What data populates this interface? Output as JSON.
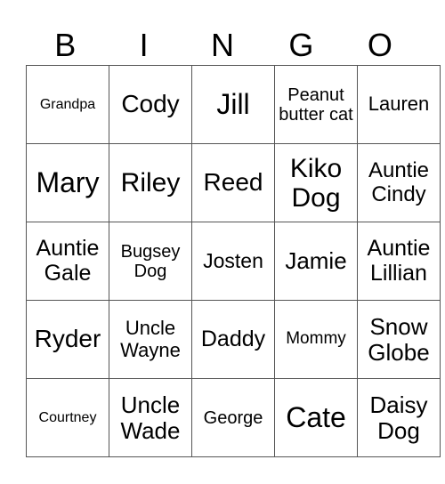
{
  "header": [
    "B",
    "I",
    "N",
    "G",
    "O"
  ],
  "rows": [
    [
      "Grandpa",
      "Cody",
      "Jill",
      "Peanut butter cat",
      "Lauren"
    ],
    [
      "Mary",
      "Riley",
      "Reed",
      "Kiko Dog",
      "Auntie Cindy"
    ],
    [
      "Auntie Gale",
      "Bugsey Dog",
      "Josten",
      "Jamie",
      "Auntie Lillian"
    ],
    [
      "Ryder",
      "Uncle Wayne",
      "Daddy",
      "Mommy",
      "Snow Globe"
    ],
    [
      "Courtney",
      "Uncle Wade",
      "George",
      "Cate",
      "Daisy Dog"
    ]
  ]
}
